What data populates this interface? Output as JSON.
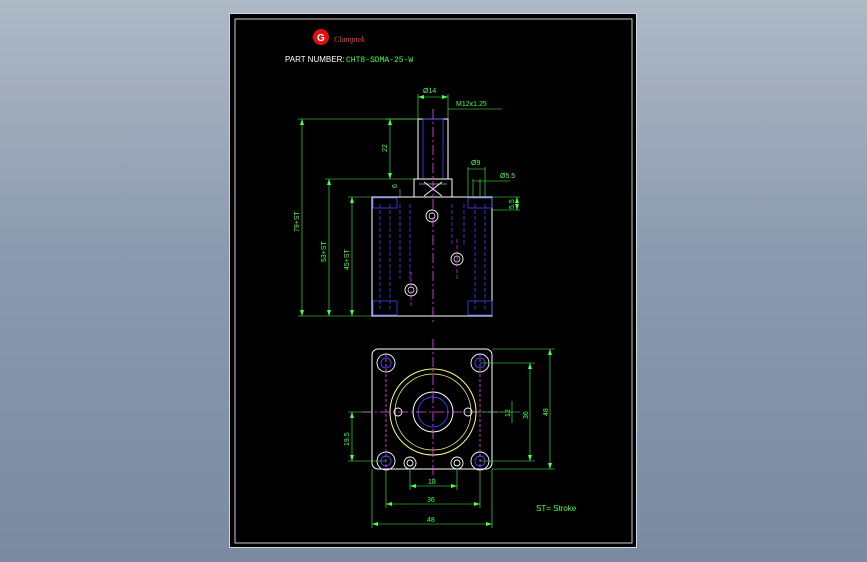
{
  "header": {
    "brand": "Clamptek",
    "part_number_label": "PART NUMBER:",
    "part_number_value": "CHT8-SDMA-25-W"
  },
  "dimensions": {
    "d14": "Ø14",
    "thread": "M12x1.25",
    "h22": "22",
    "d9": "Ø9",
    "d5_5": "Ø5.5",
    "h6": "6",
    "h5_5": "5.5",
    "h79": "79+ST",
    "h53": "53+ST",
    "h45": "45+ST",
    "v12": "12",
    "v36": "36",
    "v48": "48",
    "v19_5": "19.5",
    "w18": "18",
    "w36": "36",
    "w48": "48"
  },
  "legend": {
    "stroke_note": "ST= Stroke"
  },
  "colors": {
    "background": "#000000",
    "outline": "#ffffff",
    "part": "#4040ff",
    "dimension": "#4cff4c",
    "centerline": "#ff40ff",
    "bore": "#ffff80",
    "brand": "#ff2020"
  }
}
